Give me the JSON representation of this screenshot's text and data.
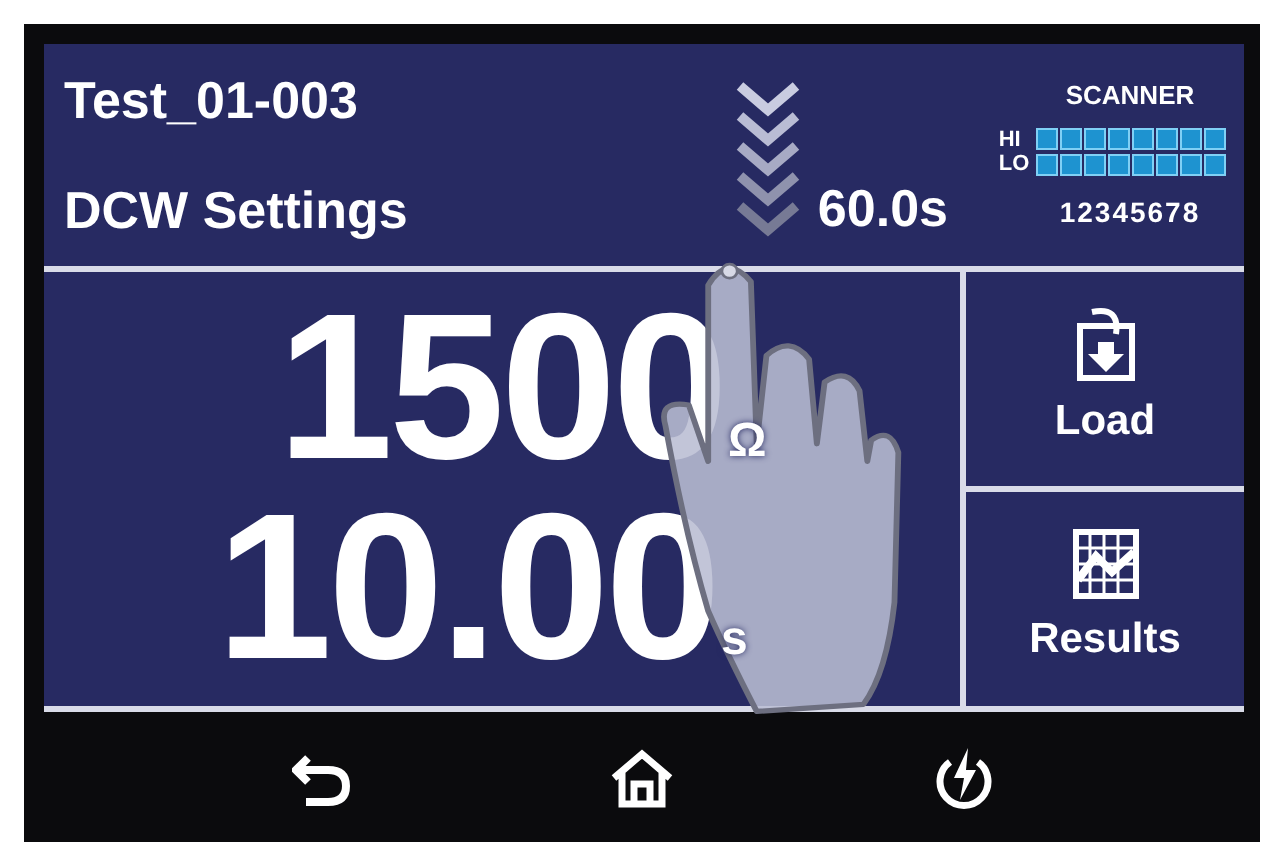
{
  "header": {
    "test_name": "Test_01-003",
    "mode": "DCW Settings",
    "ramp_time": "60.0s"
  },
  "scanner": {
    "title": "SCANNER",
    "rows": [
      {
        "label": "HI"
      },
      {
        "label": "LO"
      }
    ],
    "channels": "12345678"
  },
  "readings": [
    {
      "value": "1500",
      "unit": "Ω"
    },
    {
      "value": "10.00",
      "unit": "s"
    }
  ],
  "side_buttons": [
    {
      "kind": "load",
      "label": "Load"
    },
    {
      "kind": "results",
      "label": "Results"
    }
  ],
  "nav": [
    {
      "kind": "back"
    },
    {
      "kind": "home"
    },
    {
      "kind": "power"
    }
  ]
}
